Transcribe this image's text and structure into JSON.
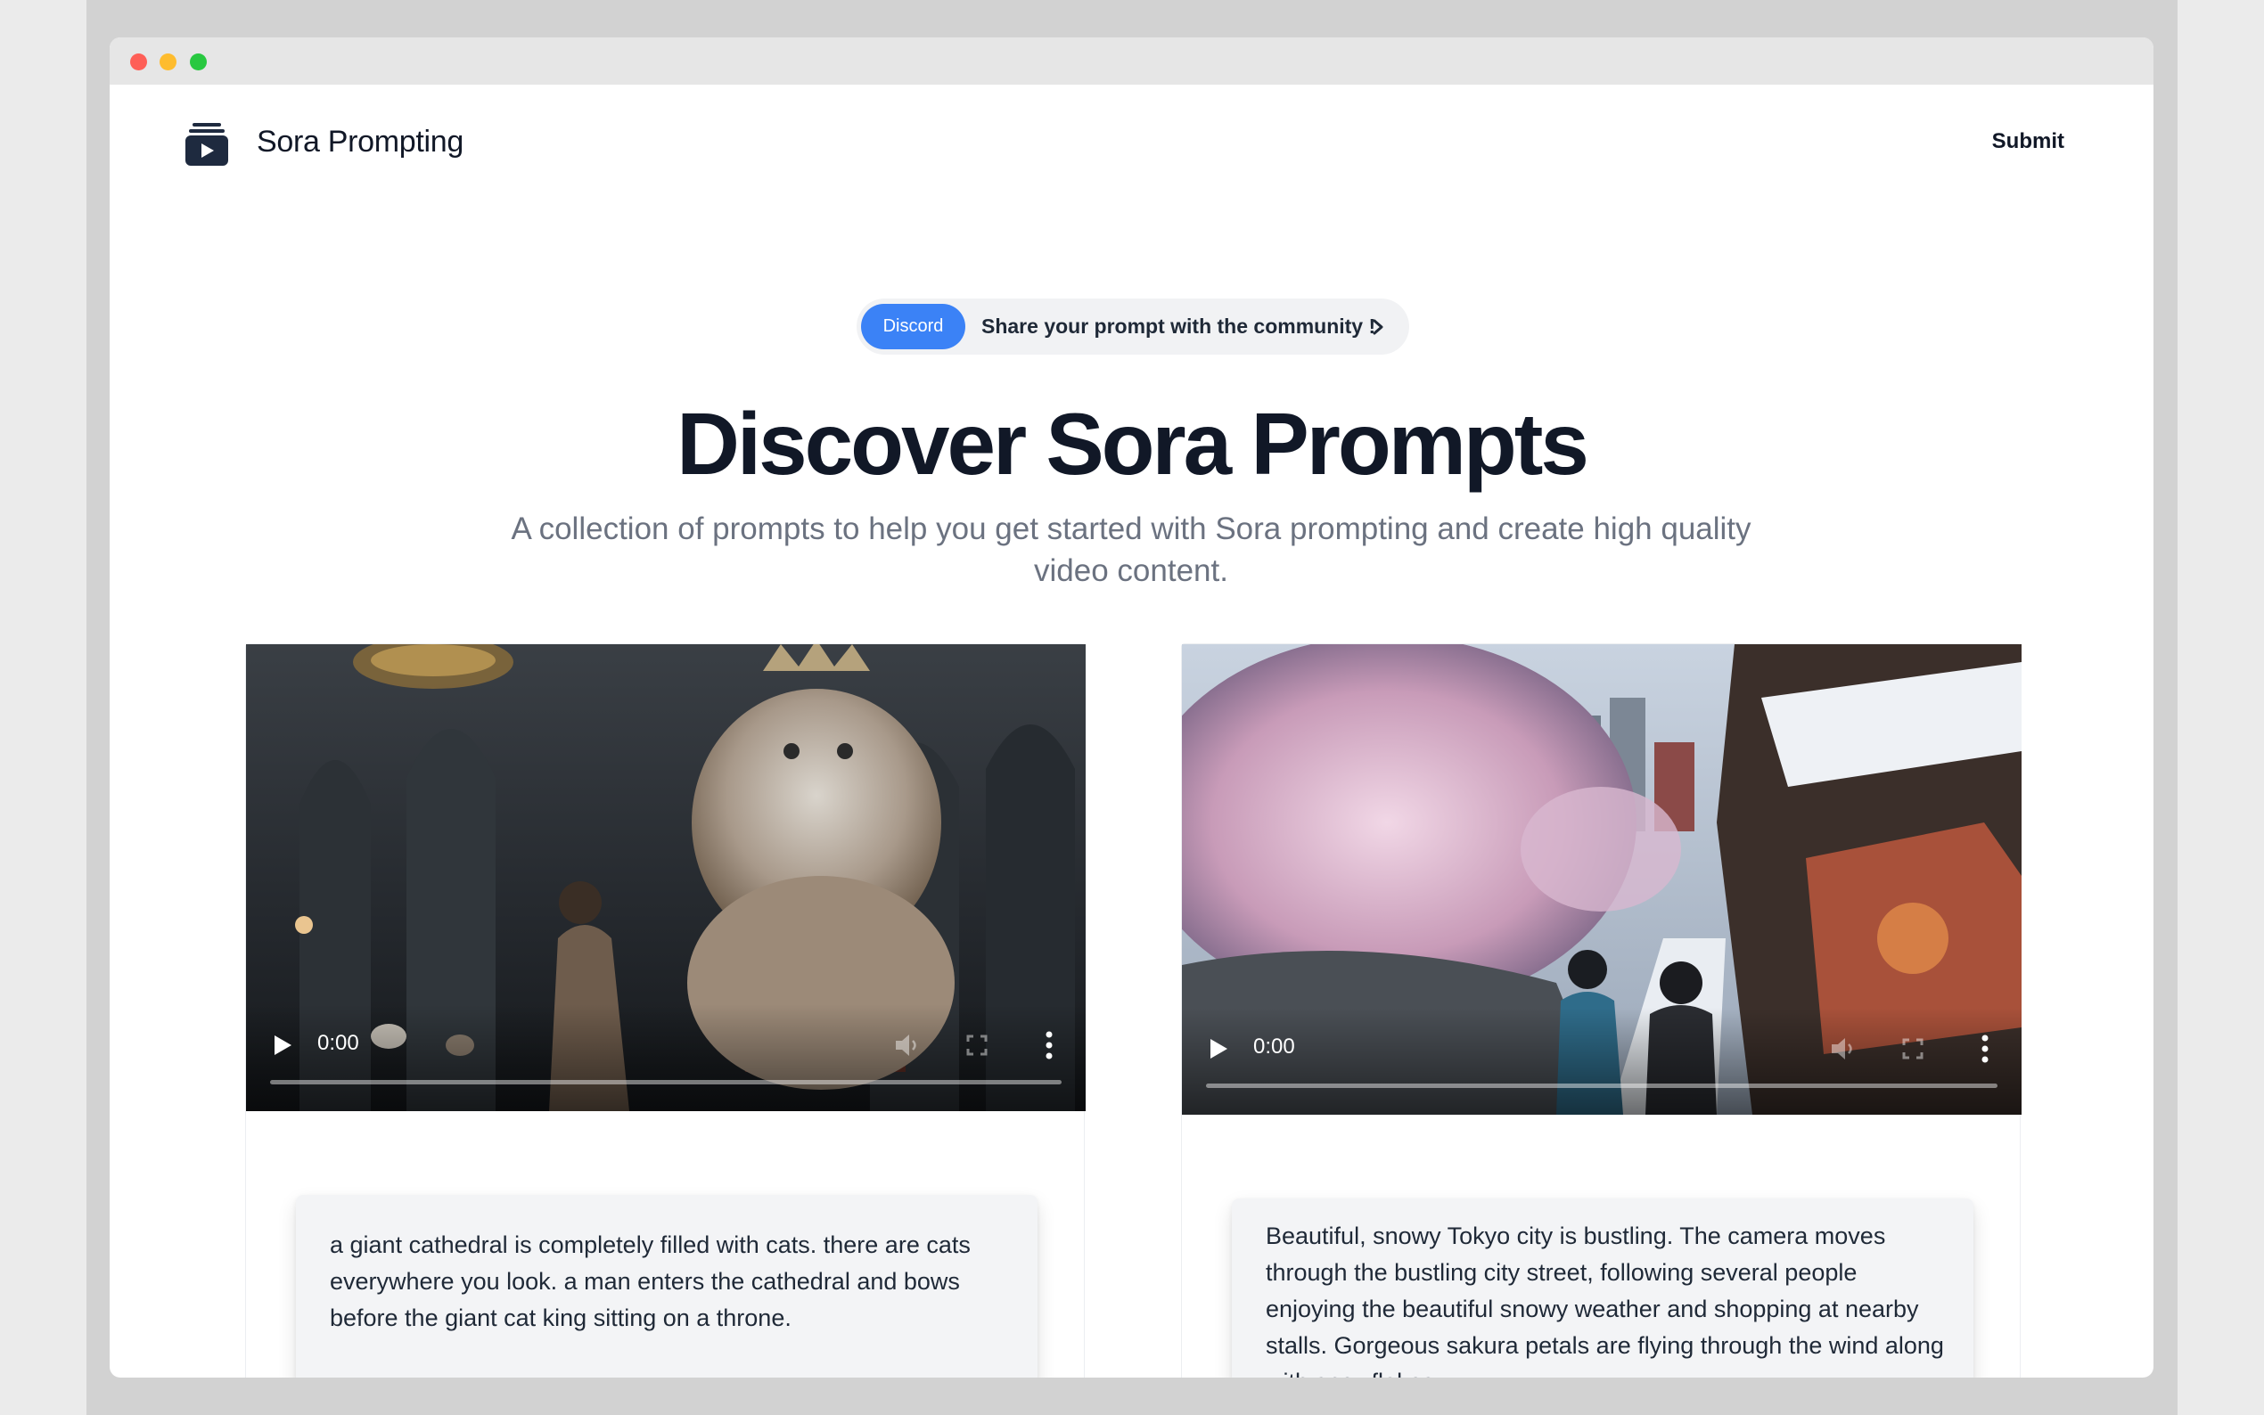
{
  "nav": {
    "brand": "Sora Prompting",
    "logo_icon": "play-box-icon",
    "submit_label": "Submit"
  },
  "announcement": {
    "badge": "Discord",
    "text": "Share your prompt with the community !",
    "chevron_icon": "chevron-right-icon"
  },
  "hero": {
    "title": "Discover Sora Prompts",
    "subtitle": "A collection of prompts to help you get started with Sora prompting and create high quality video content."
  },
  "cards": [
    {
      "video": {
        "time": "0:00",
        "icons": [
          "play-icon",
          "mute-icon",
          "fullscreen-icon",
          "more-vertical-icon"
        ]
      },
      "prompt": "a giant cathedral is completely filled with cats. there are cats everywhere you look. a man enters the cathedral and bows before the giant cat king sitting on a throne."
    },
    {
      "video": {
        "time": "0:00",
        "icons": [
          "play-icon",
          "mute-icon",
          "fullscreen-icon",
          "more-vertical-icon"
        ]
      },
      "prompt": "Beautiful, snowy Tokyo city is bustling. The camera moves through the bustling city street, following several people enjoying the beautiful snowy weather and shopping at nearby stalls. Gorgeous sakura petals are flying through the wind along with snowflakes."
    }
  ],
  "colors": {
    "accent": "#3b82f6",
    "heading": "#111827",
    "muted": "#6b7280"
  }
}
